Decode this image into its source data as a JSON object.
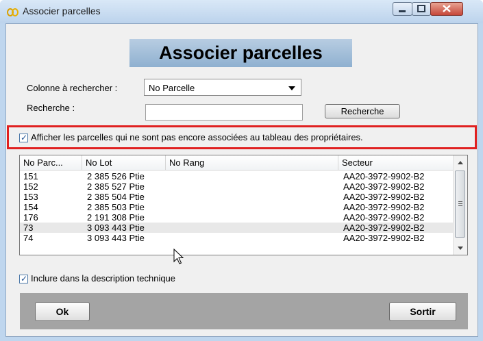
{
  "window": {
    "title": "Associer parcelles",
    "icon": "app-logo-icon"
  },
  "heading": "Associer parcelles",
  "search": {
    "column_label": "Colonne à rechercher :",
    "column_value": "No Parcelle",
    "query_label": "Recherche :",
    "query_value": "",
    "button_label": "Recherche"
  },
  "filter_checkbox": {
    "checked": true,
    "label": "Afficher les parcelles qui ne sont pas encore associées au tableau des propriétaires."
  },
  "grid": {
    "columns": [
      "No Parc...",
      "No Lot",
      "No Rang",
      "Secteur"
    ],
    "rows": [
      [
        "151",
        "2 385 526 Ptie",
        "",
        "AA20-3972-9902-B2"
      ],
      [
        "152",
        "2 385 527 Ptie",
        "",
        "AA20-3972-9902-B2"
      ],
      [
        "153",
        "2 385 504 Ptie",
        "",
        "AA20-3972-9902-B2"
      ],
      [
        "154",
        "2 385 503 Ptie",
        "",
        "AA20-3972-9902-B2"
      ],
      [
        "176",
        "2 191 308 Ptie",
        "",
        "AA20-3972-9902-B2"
      ],
      [
        "73",
        "3 093 443 Ptie",
        "",
        "AA20-3972-9902-B2"
      ],
      [
        "74",
        "3 093 443 Ptie",
        "",
        "AA20-3972-9902-B2"
      ]
    ],
    "selected_row": 5
  },
  "include_checkbox": {
    "checked": true,
    "label": "Inclure dans la description technique"
  },
  "buttons": {
    "ok": "Ok",
    "exit": "Sortir"
  },
  "colors": {
    "titlebar": "#bcd3ec",
    "heading_bg": "#9fbad6",
    "highlight": "#e02020",
    "panel": "#a4a4a4"
  }
}
